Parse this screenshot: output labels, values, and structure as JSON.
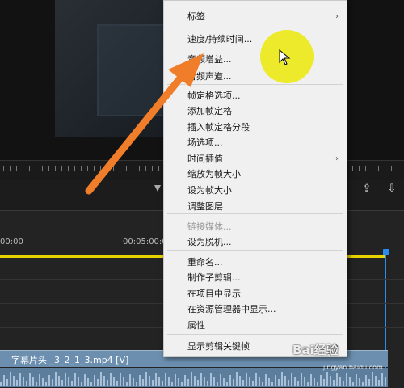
{
  "menu": {
    "items": [
      {
        "label": "标签",
        "submenu": true,
        "disabled": false
      },
      {
        "label": "速度/持续时间...",
        "submenu": false,
        "disabled": false
      },
      {
        "label": "音频增益...",
        "submenu": false,
        "disabled": false
      },
      {
        "label": "音频声道...",
        "submenu": false,
        "disabled": false
      },
      {
        "label": "帧定格选项...",
        "submenu": false,
        "disabled": false
      },
      {
        "label": "添加帧定格",
        "submenu": false,
        "disabled": false
      },
      {
        "label": "插入帧定格分段",
        "submenu": false,
        "disabled": false
      },
      {
        "label": "场选项...",
        "submenu": false,
        "disabled": false
      },
      {
        "label": "时间插值",
        "submenu": true,
        "disabled": false
      },
      {
        "label": "缩放为帧大小",
        "submenu": false,
        "disabled": false
      },
      {
        "label": "设为帧大小",
        "submenu": false,
        "disabled": false
      },
      {
        "label": "调整图层",
        "submenu": false,
        "disabled": false
      },
      {
        "label": "链接媒体...",
        "submenu": false,
        "disabled": true
      },
      {
        "label": "设为脱机...",
        "submenu": false,
        "disabled": false
      },
      {
        "label": "重命名...",
        "submenu": false,
        "disabled": false
      },
      {
        "label": "制作子剪辑...",
        "submenu": false,
        "disabled": false
      },
      {
        "label": "在项目中显示",
        "submenu": false,
        "disabled": false
      },
      {
        "label": "在资源管理器中显示...",
        "submenu": false,
        "disabled": false
      },
      {
        "label": "属性",
        "submenu": false,
        "disabled": false
      },
      {
        "label": "显示剪辑关键帧",
        "submenu": true,
        "disabled": false
      }
    ]
  },
  "timeline": {
    "timecode_start": "00:00",
    "timecode_mid": "00:05:00:00",
    "clip_label": "字幕片头 _3_2_1_3.mp4 [V]"
  },
  "watermark": {
    "text": "Bai经验",
    "sub": "jingyan.baidu.com"
  },
  "colors": {
    "highlight": "#ece91a",
    "arrow": "#f07d2a",
    "playhead": "#2d8ceb",
    "work_area": "#e8d200",
    "clip": "#6c8fb0"
  }
}
